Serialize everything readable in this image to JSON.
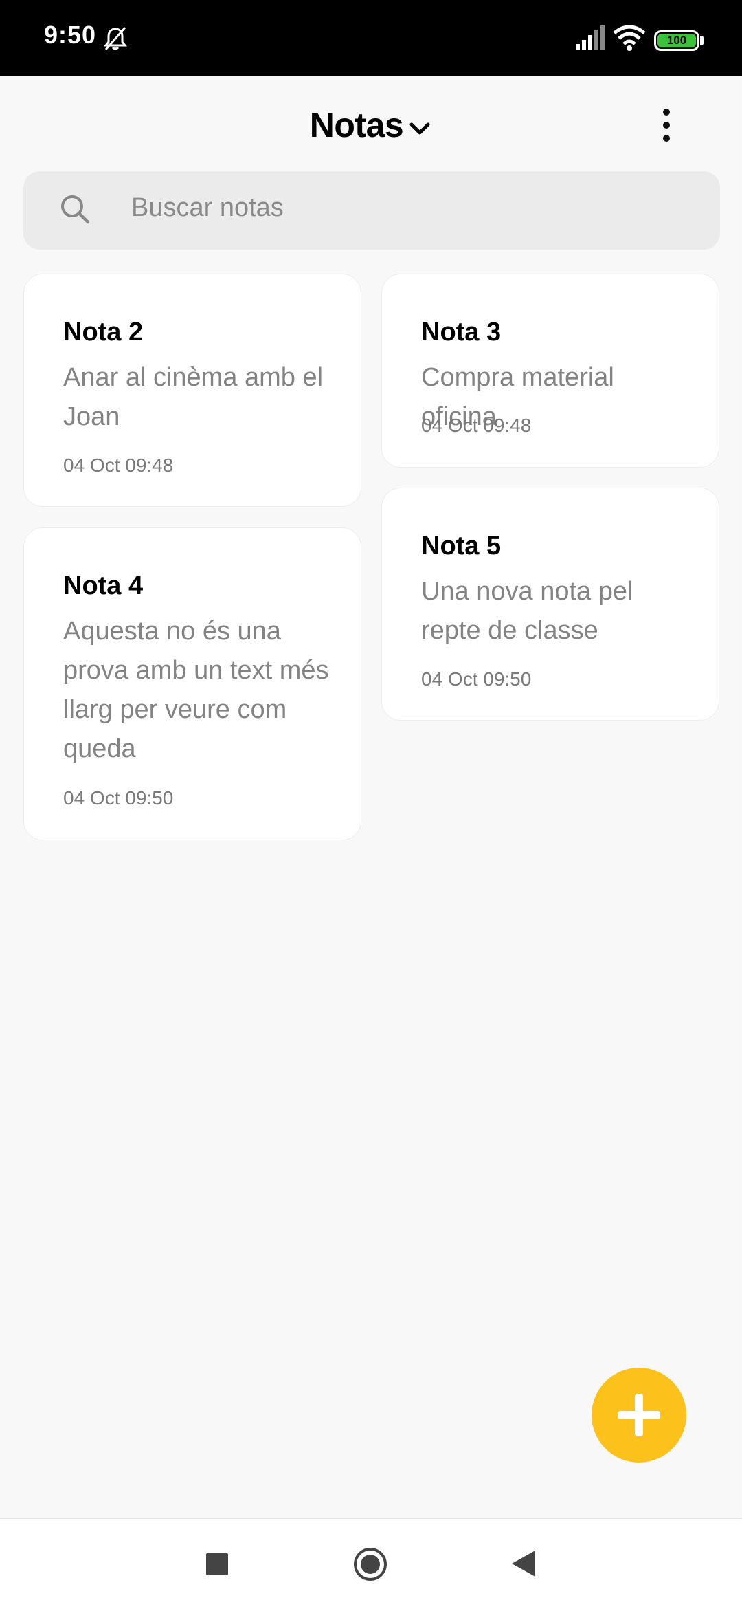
{
  "status_bar": {
    "time": "9:50",
    "battery": "100",
    "icons": [
      "bell-off-icon",
      "signal-icon",
      "wifi-icon",
      "battery-icon"
    ]
  },
  "header": {
    "title": "Notas"
  },
  "search": {
    "placeholder": "Buscar notas"
  },
  "notes": [
    {
      "title": "Nota 2",
      "body": "Anar al cinèma amb el Joan",
      "date": "04 Oct 09:48"
    },
    {
      "title": "Nota 3",
      "body": "Compra material oficina",
      "date": "04 Oct 09:48"
    },
    {
      "title": "Nota 4",
      "body": "Aquesta no és una prova amb un text més llarg per veure com queda",
      "date": "04 Oct 09:50"
    },
    {
      "title": "Nota 5",
      "body": "Una nova nota pel repte de classe",
      "date": "04 Oct 09:50"
    }
  ],
  "colors": {
    "fab": "#fcc21b",
    "background": "#f8f8f8",
    "card": "#ffffff"
  }
}
